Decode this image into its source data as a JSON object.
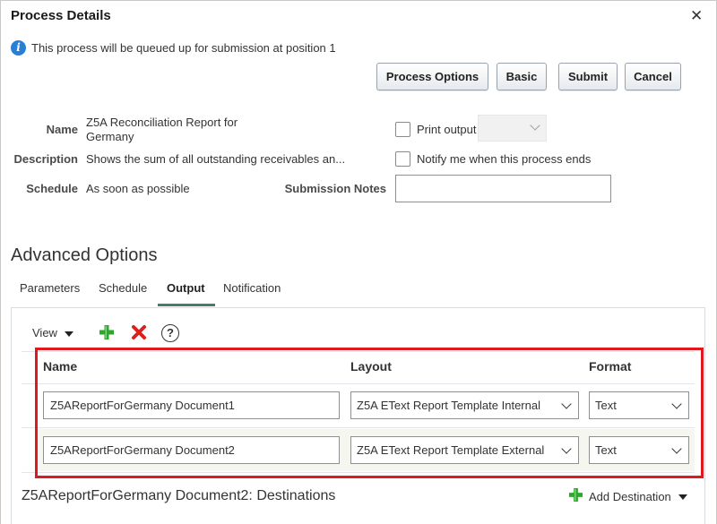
{
  "dialog": {
    "title": "Process Details",
    "close_icon": "close-icon",
    "info_icon": "info-icon",
    "info_message": "This process will be queued up for submission at position 1"
  },
  "buttons": {
    "process_options": "Process Options",
    "basic": "Basic",
    "submit": "Submit",
    "cancel": "Cancel"
  },
  "details": {
    "name_label": "Name",
    "name_value_line1": "Z5A Reconciliation Report for",
    "name_value_line2": "Germany",
    "description_label": "Description",
    "description_value": "Shows the sum of all outstanding receivables an...",
    "schedule_label": "Schedule",
    "schedule_value": "As soon as possible",
    "print_output_label": "Print output",
    "print_output_checked": false,
    "notify_label": "Notify me when this process ends",
    "notify_checked": false,
    "submission_notes_label": "Submission Notes",
    "submission_notes_value": ""
  },
  "advanced": {
    "title": "Advanced Options",
    "tabs": [
      {
        "label": "Parameters",
        "active": false
      },
      {
        "label": "Schedule",
        "active": false
      },
      {
        "label": "Output",
        "active": true
      },
      {
        "label": "Notification",
        "active": false
      }
    ]
  },
  "output": {
    "toolbar": {
      "view_label": "View",
      "add_icon": "plus-icon",
      "delete_icon": "delete-x-icon",
      "help_icon": "help-icon"
    },
    "columns": {
      "name": "Name",
      "layout": "Layout",
      "format": "Format"
    },
    "rows": [
      {
        "name": "Z5AReportForGermany Document1",
        "layout": "Z5A EText Report Template Internal",
        "format": "Text"
      },
      {
        "name": "Z5AReportForGermany Document2",
        "layout": "Z5A EText Report Template External",
        "format": "Text"
      }
    ],
    "destinations_title": "Z5AReportForGermany Document2: Destinations",
    "add_destination_label": "Add Destination"
  },
  "colors": {
    "highlight_border": "#e0191f",
    "info_blue": "#2a7fd4",
    "add_green": "#2ea62e",
    "delete_red": "#d9221c",
    "active_tab_underline": "#4a7a6d"
  }
}
